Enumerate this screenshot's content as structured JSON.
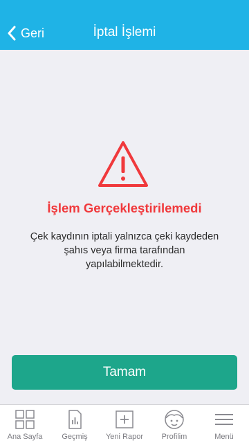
{
  "header": {
    "back_label": "Geri",
    "title": "İptal İşlemi",
    "background": "#1fb3e6"
  },
  "error": {
    "icon": "warning-triangle-icon",
    "title": "İşlem Gerçekleştirilemedi",
    "message": "Çek kaydının iptali yalnızca çeki kaydeden şahıs veya firma tarafından yapılabilmektedir.",
    "color": "#f0393c"
  },
  "button": {
    "label": "Tamam",
    "color": "#1da68b"
  },
  "tabbar": {
    "items": [
      {
        "label": "Ana Sayfa",
        "icon": "grid-icon"
      },
      {
        "label": "Geçmiş",
        "icon": "history-chart-icon"
      },
      {
        "label": "Yeni Rapor",
        "icon": "plus-icon"
      },
      {
        "label": "Profilim",
        "icon": "profile-face-icon"
      },
      {
        "label": "Menü",
        "icon": "menu-icon"
      }
    ]
  }
}
